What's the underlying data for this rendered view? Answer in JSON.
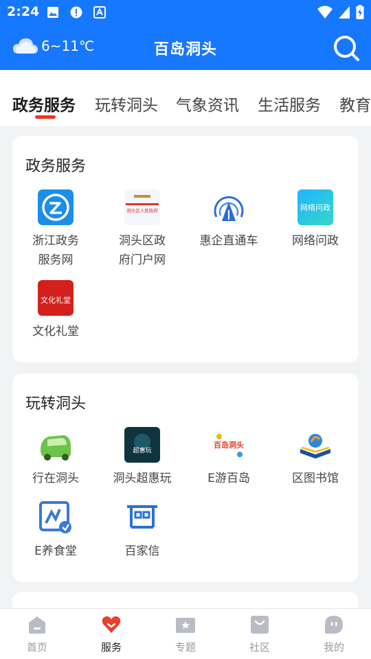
{
  "status_bar": {
    "time": "2:24"
  },
  "header": {
    "weather": "6~11℃",
    "title": "百岛洞头"
  },
  "tabs": [
    {
      "label": "政务服务",
      "active": true
    },
    {
      "label": "玩转洞头",
      "active": false
    },
    {
      "label": "气象资讯",
      "active": false
    },
    {
      "label": "生活服务",
      "active": false
    },
    {
      "label": "教育",
      "active": false
    }
  ],
  "sections": [
    {
      "title": "政务服务",
      "items": [
        {
          "label": "浙江政务\n服务网",
          "icon": "zhejiang-gov-icon"
        },
        {
          "label": "洞头区政\n府门户网",
          "icon": "dongtou-gov-portal-icon"
        },
        {
          "label": "惠企直通车",
          "icon": "enterprise-direct-icon"
        },
        {
          "label": "网络问政",
          "icon": "online-consult-icon"
        },
        {
          "label": "文化礼堂",
          "icon": "culture-hall-icon"
        }
      ]
    },
    {
      "title": "玩转洞头",
      "items": [
        {
          "label": "行在洞头",
          "icon": "car-icon"
        },
        {
          "label": "洞头超惠玩",
          "icon": "deals-icon"
        },
        {
          "label": "E游百岛",
          "icon": "travel-icon"
        },
        {
          "label": "区图书馆",
          "icon": "library-icon"
        },
        {
          "label": "E养食堂",
          "icon": "canteen-icon"
        },
        {
          "label": "百家信",
          "icon": "letters-icon"
        }
      ]
    }
  ],
  "portal_text": "洞头区人民政府",
  "deals_text": "超惠玩",
  "online_consult_text": "网络问政",
  "travel_text": "百岛洞头",
  "culture_text": "文化礼堂",
  "bottom_nav": [
    {
      "label": "首页",
      "active": false
    },
    {
      "label": "服务",
      "active": true
    },
    {
      "label": "专题",
      "active": false
    },
    {
      "label": "社区",
      "active": false
    },
    {
      "label": "我的",
      "active": false
    }
  ],
  "colors": {
    "brand": "#1677ff",
    "accent": "#f0321e"
  }
}
